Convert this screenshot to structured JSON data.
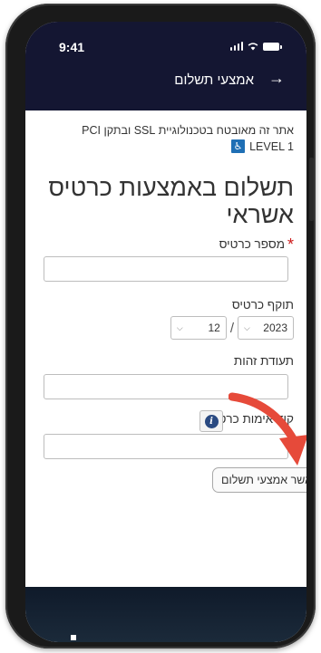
{
  "status": {
    "time": "9:41"
  },
  "nav": {
    "title": "אמצעי תשלום",
    "back_glyph": "→"
  },
  "security": {
    "note": "אתר זה מאובטח בטכנולוגיית SSL ובתקן PCI",
    "level": "LEVEL 1",
    "level_icon": "accessibility-icon"
  },
  "page": {
    "title": "תשלום באמצעות כרטיס אשראי"
  },
  "form": {
    "card_number_label": "מספר כרטיס",
    "required_mark": "*",
    "expiry_label": "תוקף כרטיס",
    "expiry_month": "12",
    "expiry_year": "2023",
    "expiry_separator": "/",
    "id_label": "תעודת זהות",
    "cvv_label": "קוד אימות כרטיס",
    "info_glyph": "i",
    "confirm_label": "אשר אמצעי תשלום"
  },
  "colors": {
    "nav_bg": "#141632",
    "arrow": "#e64a3a",
    "required": "#cc1a1a"
  }
}
